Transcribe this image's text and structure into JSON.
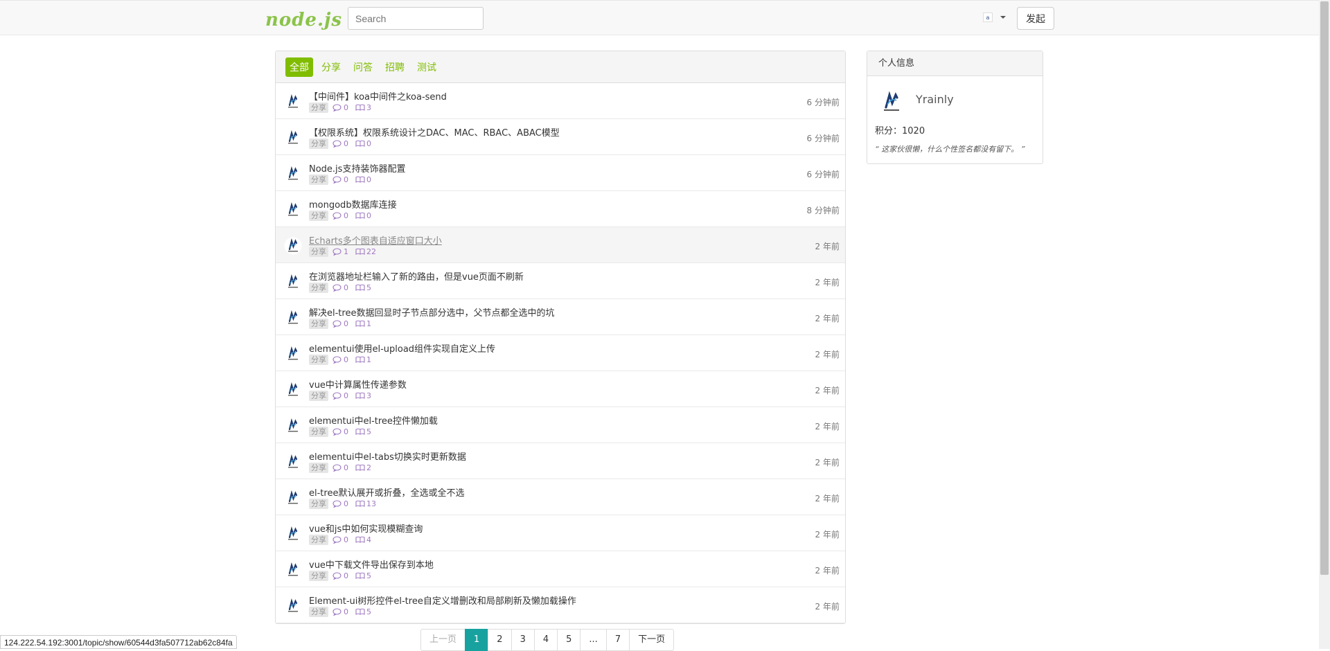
{
  "header": {
    "logo": "node.js",
    "search_placeholder": "Search",
    "user_avatar_text": "a",
    "post_button": "发起"
  },
  "tabs": [
    {
      "label": "全部",
      "active": true
    },
    {
      "label": "分享",
      "active": false
    },
    {
      "label": "问答",
      "active": false
    },
    {
      "label": "招聘",
      "active": false
    },
    {
      "label": "测试",
      "active": false
    }
  ],
  "topics": [
    {
      "title": "【中间件】koa中间件之koa-send",
      "tag": "分享",
      "replies": "0",
      "views": "3",
      "time": "6 分钟前"
    },
    {
      "title": "【权限系统】权限系统设计之DAC、MAC、RBAC、ABAC模型",
      "tag": "分享",
      "replies": "0",
      "views": "0",
      "time": "6 分钟前"
    },
    {
      "title": "Node.js支持装饰器配置",
      "tag": "分享",
      "replies": "0",
      "views": "0",
      "time": "6 分钟前"
    },
    {
      "title": "mongodb数据库连接",
      "tag": "分享",
      "replies": "0",
      "views": "0",
      "time": "8 分钟前"
    },
    {
      "title": "Echarts多个图表自适应窗口大小",
      "tag": "分享",
      "replies": "1",
      "views": "22",
      "time": "2 年前"
    },
    {
      "title": "在浏览器地址栏输入了新的路由，但是vue页面不刷新",
      "tag": "分享",
      "replies": "0",
      "views": "5",
      "time": "2 年前"
    },
    {
      "title": "解决el-tree数据回显时子节点部分选中，父节点都全选中的坑",
      "tag": "分享",
      "replies": "0",
      "views": "1",
      "time": "2 年前"
    },
    {
      "title": "elementui使用el-upload组件实现自定义上传",
      "tag": "分享",
      "replies": "0",
      "views": "1",
      "time": "2 年前"
    },
    {
      "title": "vue中计算属性传递参数",
      "tag": "分享",
      "replies": "0",
      "views": "3",
      "time": "2 年前"
    },
    {
      "title": "elementui中el-tree控件懒加载",
      "tag": "分享",
      "replies": "0",
      "views": "5",
      "time": "2 年前"
    },
    {
      "title": "elementui中el-tabs切换实时更新数据",
      "tag": "分享",
      "replies": "0",
      "views": "2",
      "time": "2 年前"
    },
    {
      "title": "el-tree默认展开或折叠，全选或全不选",
      "tag": "分享",
      "replies": "0",
      "views": "13",
      "time": "2 年前"
    },
    {
      "title": "vue和js中如何实现模糊查询",
      "tag": "分享",
      "replies": "0",
      "views": "4",
      "time": "2 年前"
    },
    {
      "title": "vue中下载文件导出保存到本地",
      "tag": "分享",
      "replies": "0",
      "views": "5",
      "time": "2 年前"
    },
    {
      "title": "Element-ui树形控件el-tree自定义增删改和局部刷新及懒加载操作",
      "tag": "分享",
      "replies": "0",
      "views": "5",
      "time": "2 年前"
    }
  ],
  "hovered_index": 4,
  "pagination": [
    "上一页",
    "1",
    "2",
    "3",
    "4",
    "5",
    "...",
    "7",
    "下一页"
  ],
  "current_page": "1",
  "sidebar": {
    "title": "个人信息",
    "username": "Yrainly",
    "score": "积分：1020",
    "signature": "“ 这家伙很懒，什么个性签名都没有留下。 ”"
  },
  "status_url": "124.222.54.192:3001/topic/show/60544d3fa507712ab62c84fa",
  "colors": {
    "accent": "#80bd01",
    "page_active": "#17a2a0"
  }
}
